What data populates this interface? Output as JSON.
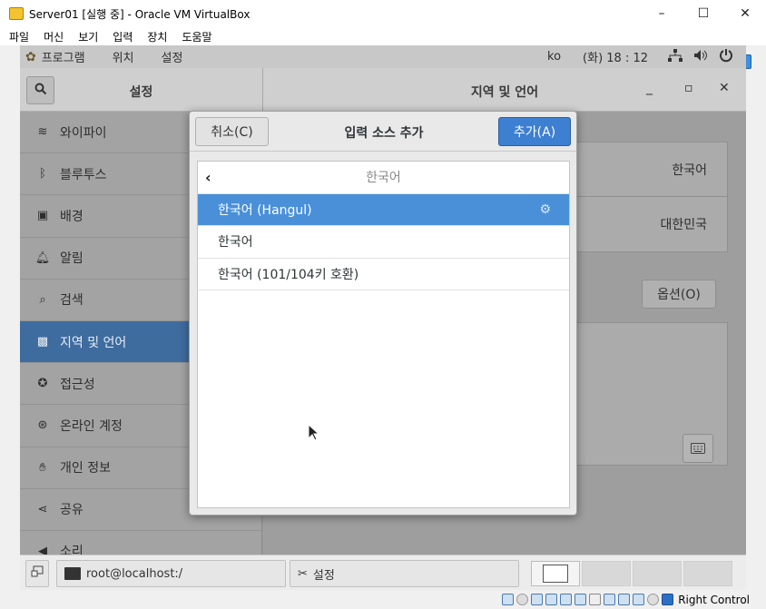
{
  "window": {
    "title": "Server01 [실행 중] - Oracle VM VirtualBox",
    "minimize": "–",
    "maximize": "☐",
    "close": "✕"
  },
  "menubar": [
    "파일",
    "머신",
    "보기",
    "입력",
    "장치",
    "도움말"
  ],
  "topbar": {
    "apps": "프로그램",
    "places": "위치",
    "settings": "설정",
    "lang": "ko",
    "clock": "(화) 18 : 12"
  },
  "settings": {
    "left_title": "설정",
    "right_title": "지역 및 언어",
    "sidebar": [
      {
        "label": "와이파이",
        "icon": "wifi-icon",
        "glyph": "≋"
      },
      {
        "label": "블루투스",
        "icon": "bluetooth-icon",
        "glyph": "ᛒ"
      },
      {
        "label": "배경",
        "icon": "background-icon",
        "glyph": "▣"
      },
      {
        "label": "알림",
        "icon": "bell-icon",
        "glyph": "🔔︎"
      },
      {
        "label": "검색",
        "icon": "search-icon",
        "glyph": "⌕"
      },
      {
        "label": "지역 및 언어",
        "icon": "region-icon",
        "glyph": "▩"
      },
      {
        "label": "접근성",
        "icon": "accessibility-icon",
        "glyph": "✪"
      },
      {
        "label": "온라인 계정",
        "icon": "online-accounts-icon",
        "glyph": "⊛"
      },
      {
        "label": "개인 정보",
        "icon": "privacy-icon",
        "glyph": "✋︎"
      },
      {
        "label": "공유",
        "icon": "share-icon",
        "glyph": "⋖"
      },
      {
        "label": "소리",
        "icon": "sound-icon",
        "glyph": "◀"
      }
    ],
    "language_value": "한국어",
    "formats_value": "대한민국",
    "options_button": "옵션(O)"
  },
  "dialog": {
    "cancel": "취소(C)",
    "title": "입력 소스 추가",
    "add": "추가(A)",
    "back_label": "한국어",
    "items": [
      {
        "label": "한국어 (Hangul)"
      },
      {
        "label": "한국어"
      },
      {
        "label": "한국어 (101/104키 호환)"
      }
    ]
  },
  "taskbar": {
    "terminal": "root@localhost:/",
    "settings": "설정"
  },
  "statusbar": {
    "host_key": "Right Control"
  }
}
